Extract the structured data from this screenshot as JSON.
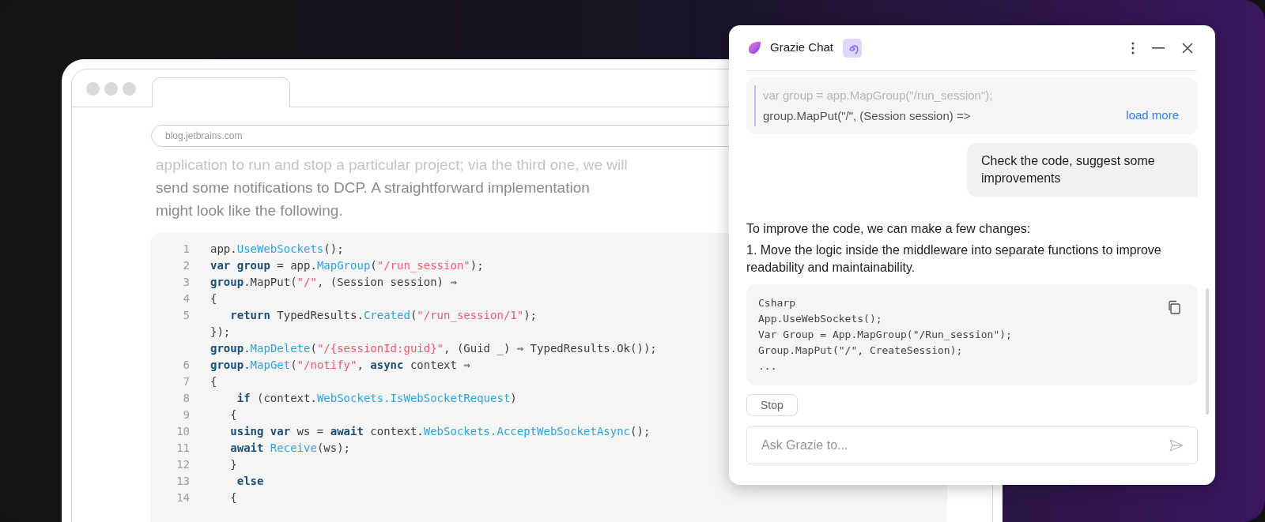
{
  "browser": {
    "url": "blog.jetbrains.com",
    "paragraph": [
      {
        "text": "application to run and stop a particular project; via the third one, we will",
        "faded": true
      },
      {
        "text": "send some notifications to DCP. A straightforward implementation",
        "faded": false
      },
      {
        "text": "might look like the following.",
        "faded": false
      }
    ],
    "code": [
      {
        "number": "1",
        "tokens": [
          {
            "kind": "plain",
            "text": "app."
          },
          {
            "kind": "method",
            "text": "UseWebSockets"
          },
          {
            "kind": "plain",
            "text": "();"
          }
        ]
      },
      {
        "number": "2",
        "tokens": [
          {
            "kind": "keyword",
            "text": "var group"
          },
          {
            "kind": "plain",
            "text": " = app."
          },
          {
            "kind": "method",
            "text": "MapGroup"
          },
          {
            "kind": "plain",
            "text": "("
          },
          {
            "kind": "string",
            "text": "\"/run_session\""
          },
          {
            "kind": "plain",
            "text": ");"
          }
        ]
      },
      {
        "number": "3",
        "tokens": [
          {
            "kind": "keyword",
            "text": "group"
          },
          {
            "kind": "plain",
            "text": ".MapPut("
          },
          {
            "kind": "string",
            "text": "\"/\""
          },
          {
            "kind": "plain",
            "text": ", (Session session) ⇒"
          }
        ]
      },
      {
        "number": "4",
        "tokens": [
          {
            "kind": "plain",
            "text": "{"
          }
        ]
      },
      {
        "number": "5",
        "tokens": [
          {
            "kind": "keyword",
            "text": "   return"
          },
          {
            "kind": "plain",
            "text": " TypedResults."
          },
          {
            "kind": "method",
            "text": "Created"
          },
          {
            "kind": "plain",
            "text": "("
          },
          {
            "kind": "string",
            "text": "\"/run_session/1\""
          },
          {
            "kind": "plain",
            "text": ");"
          }
        ]
      },
      {
        "tokens": [
          {
            "kind": "plain",
            "text": "});"
          }
        ]
      },
      {
        "tokens": [
          {
            "kind": "keyword",
            "text": "group"
          },
          {
            "kind": "plain",
            "text": "."
          },
          {
            "kind": "method",
            "text": "MapDelete"
          },
          {
            "kind": "plain",
            "text": "("
          },
          {
            "kind": "string",
            "text": "\"/{sessionId:guid}\""
          },
          {
            "kind": "plain",
            "text": ", (Guid _) ⇒ TypedResults.Ok());"
          }
        ]
      },
      {
        "number": "6",
        "tokens": [
          {
            "kind": "keyword",
            "text": "group"
          },
          {
            "kind": "plain",
            "text": "."
          },
          {
            "kind": "method",
            "text": "MapGet"
          },
          {
            "kind": "plain",
            "text": "("
          },
          {
            "kind": "string",
            "text": "\"/notify\""
          },
          {
            "kind": "plain",
            "text": ", "
          },
          {
            "kind": "keyword",
            "text": "async"
          },
          {
            "kind": "plain",
            "text": " context ⇒"
          }
        ]
      },
      {
        "number": "7",
        "tokens": [
          {
            "kind": "plain",
            "text": "{"
          }
        ]
      },
      {
        "number": "8",
        "tokens": [
          {
            "kind": "keyword",
            "text": "    if"
          },
          {
            "kind": "plain",
            "text": " (context."
          },
          {
            "kind": "method",
            "text": "WebSockets.IsWebSocketRequest"
          },
          {
            "kind": "plain",
            "text": ")"
          }
        ]
      },
      {
        "number": "9",
        "tokens": [
          {
            "kind": "plain",
            "text": "   {"
          }
        ]
      },
      {
        "number": "10",
        "tokens": [
          {
            "kind": "keyword",
            "text": "   using var"
          },
          {
            "kind": "plain",
            "text": " ws = "
          },
          {
            "kind": "keyword",
            "text": "await"
          },
          {
            "kind": "plain",
            "text": " context."
          },
          {
            "kind": "method",
            "text": "WebSockets.AcceptWebSocketAsync"
          },
          {
            "kind": "plain",
            "text": "();"
          }
        ]
      },
      {
        "number": "11",
        "tokens": [
          {
            "kind": "keyword",
            "text": "   await"
          },
          {
            "kind": "method",
            "text": " Receive"
          },
          {
            "kind": "plain",
            "text": "(ws);"
          }
        ]
      },
      {
        "number": "12",
        "tokens": [
          {
            "kind": "plain",
            "text": "   }"
          }
        ]
      },
      {
        "number": "13",
        "tokens": [
          {
            "kind": "keyword",
            "text": "    else"
          }
        ]
      },
      {
        "number": "14",
        "tokens": [
          {
            "kind": "plain",
            "text": "   {"
          }
        ]
      }
    ]
  },
  "chat": {
    "title": "Grazie Chat",
    "quote": [
      {
        "text": "var group = app.MapGroup(\"/run_session\");",
        "faded": true
      },
      {
        "text": "group.MapPut(\"/\", (Session session) =>",
        "faded": false
      }
    ],
    "load_more": "load more",
    "user_message": "Check the code, suggest some improvements",
    "answer": [
      "To improve the code, we can make a few changes:",
      "1. Move the logic inside the middleware into separate functions to improve readability and maintainability."
    ],
    "answer_code": [
      "Csharp",
      "App.UseWebSockets();",
      "Var Group = App.MapGroup(\"/Run_session\");",
      "Group.MapPut(\"/\", CreateSession);",
      "..."
    ],
    "stop_button": "Stop",
    "input": {
      "placeholder": "Ask Grazie to..."
    }
  }
}
